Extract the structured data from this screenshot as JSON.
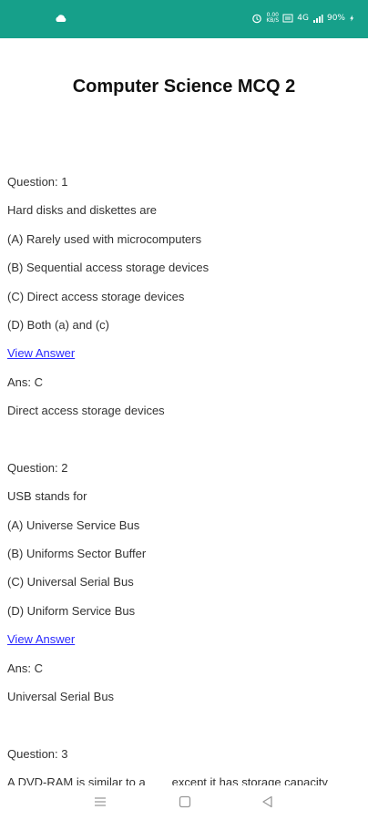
{
  "status_bar": {
    "battery_text": "90%",
    "signal_text": "4G",
    "network_text": "0.00 KB/S"
  },
  "page": {
    "title": "Computer Science MCQ 2"
  },
  "questions": [
    {
      "number_label": "Question: 1",
      "question": "Hard disks and diskettes are",
      "options": [
        "(A) Rarely used with microcomputers",
        "(B) Sequential access storage devices",
        "(C) Direct access storage devices",
        "(D) Both (a) and (c)"
      ],
      "view_answer_label": "View Answer",
      "answer_label": "Ans: C",
      "explanation": "Direct access storage devices"
    },
    {
      "number_label": "Question: 2",
      "question": "USB stands for",
      "options": [
        "(A) Universe Service Bus",
        "(B) Uniforms Sector Buffer",
        "(C) Universal Serial Bus",
        "(D) Uniform Service Bus"
      ],
      "view_answer_label": "View Answer",
      "answer_label": "Ans: C",
      "explanation": "Universal Serial Bus"
    },
    {
      "number_label": "Question: 3",
      "question": "A DVD-RAM is similar to a ___ except it has storage capacity"
    }
  ],
  "nav": {
    "menu_icon": "menu-icon",
    "home_icon": "home-square-icon",
    "back_icon": "back-triangle-icon"
  }
}
